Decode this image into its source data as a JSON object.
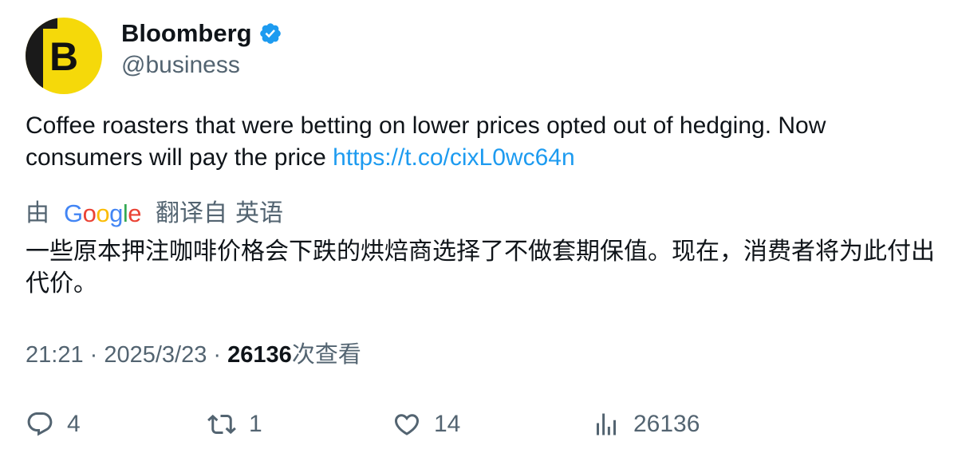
{
  "author": {
    "display_name": "Bloomberg",
    "handle": "@business",
    "verified": true,
    "avatar_letter": "B",
    "avatar_color": "#f5d90a"
  },
  "tweet": {
    "text": "Coffee roasters that were betting on lower prices opted out of hedging. Now consumers will pay the price ",
    "link": "https://t.co/cixL0wc64n"
  },
  "translation": {
    "by_label": "由",
    "provider": "Google",
    "from_label": "翻译自",
    "language": "英语",
    "text": "一些原本押注咖啡价格会下跌的烘焙商选择了不做套期保值。现在，消费者将为此付出代价。"
  },
  "meta": {
    "time": "21:21",
    "separator": " · ",
    "date": "2025/3/23",
    "views_count": "26136",
    "views_label": "次查看"
  },
  "actions": {
    "replies": "4",
    "retweets": "1",
    "likes": "14",
    "views": "26136"
  },
  "colors": {
    "link": "#1d9bf0",
    "secondary_text": "#536471",
    "primary_text": "#0f1419",
    "verified": "#1d9bf0"
  }
}
